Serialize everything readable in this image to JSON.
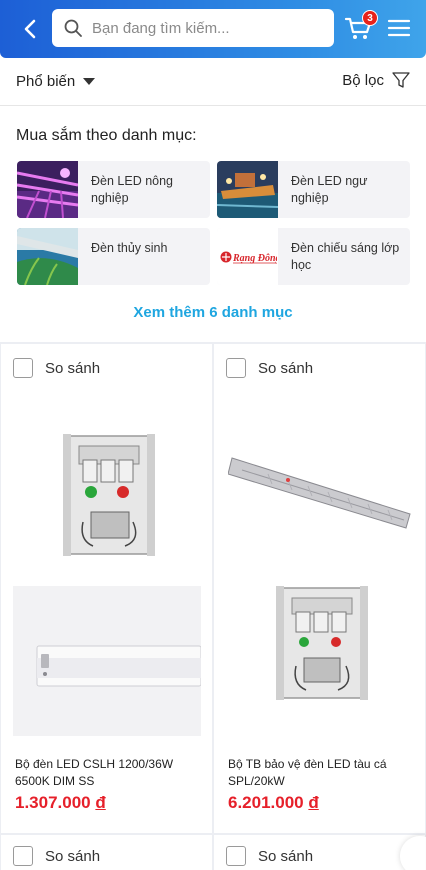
{
  "search": {
    "placeholder": "Bạn đang tìm kiếm..."
  },
  "cart": {
    "count": "3"
  },
  "sort": {
    "label": "Phổ biến"
  },
  "filter": {
    "label": "Bộ lọc"
  },
  "categories": {
    "title": "Mua sắm theo danh mục:",
    "items": [
      {
        "label": "Đèn LED nông nghiệp"
      },
      {
        "label": "Đèn LED ngư nghiệp"
      },
      {
        "label": "Đèn thủy sinh"
      },
      {
        "label": "Đèn chiếu sáng lớp học"
      }
    ],
    "logo_text": "Rạng Đông",
    "more_label": "Xem thêm 6 danh mục"
  },
  "products": [
    {
      "compare_label": "So sánh",
      "name": "Bộ đèn LED CSLH 1200/36W 6500K DIM SS",
      "price": "1.307.000",
      "currency": "đ"
    },
    {
      "compare_label": "So sánh",
      "name": "Bộ TB bảo vệ đèn LED tàu cá SPL/20kW",
      "price": "6.201.000",
      "currency": "đ"
    },
    {
      "compare_label": "So sánh"
    },
    {
      "compare_label": "So sánh"
    }
  ],
  "colors": {
    "header_start": "#1d5fd6",
    "header_end": "#3fa4ea",
    "price": "#e6202a",
    "link": "#1fa6e0",
    "badge": "#e8221b"
  }
}
